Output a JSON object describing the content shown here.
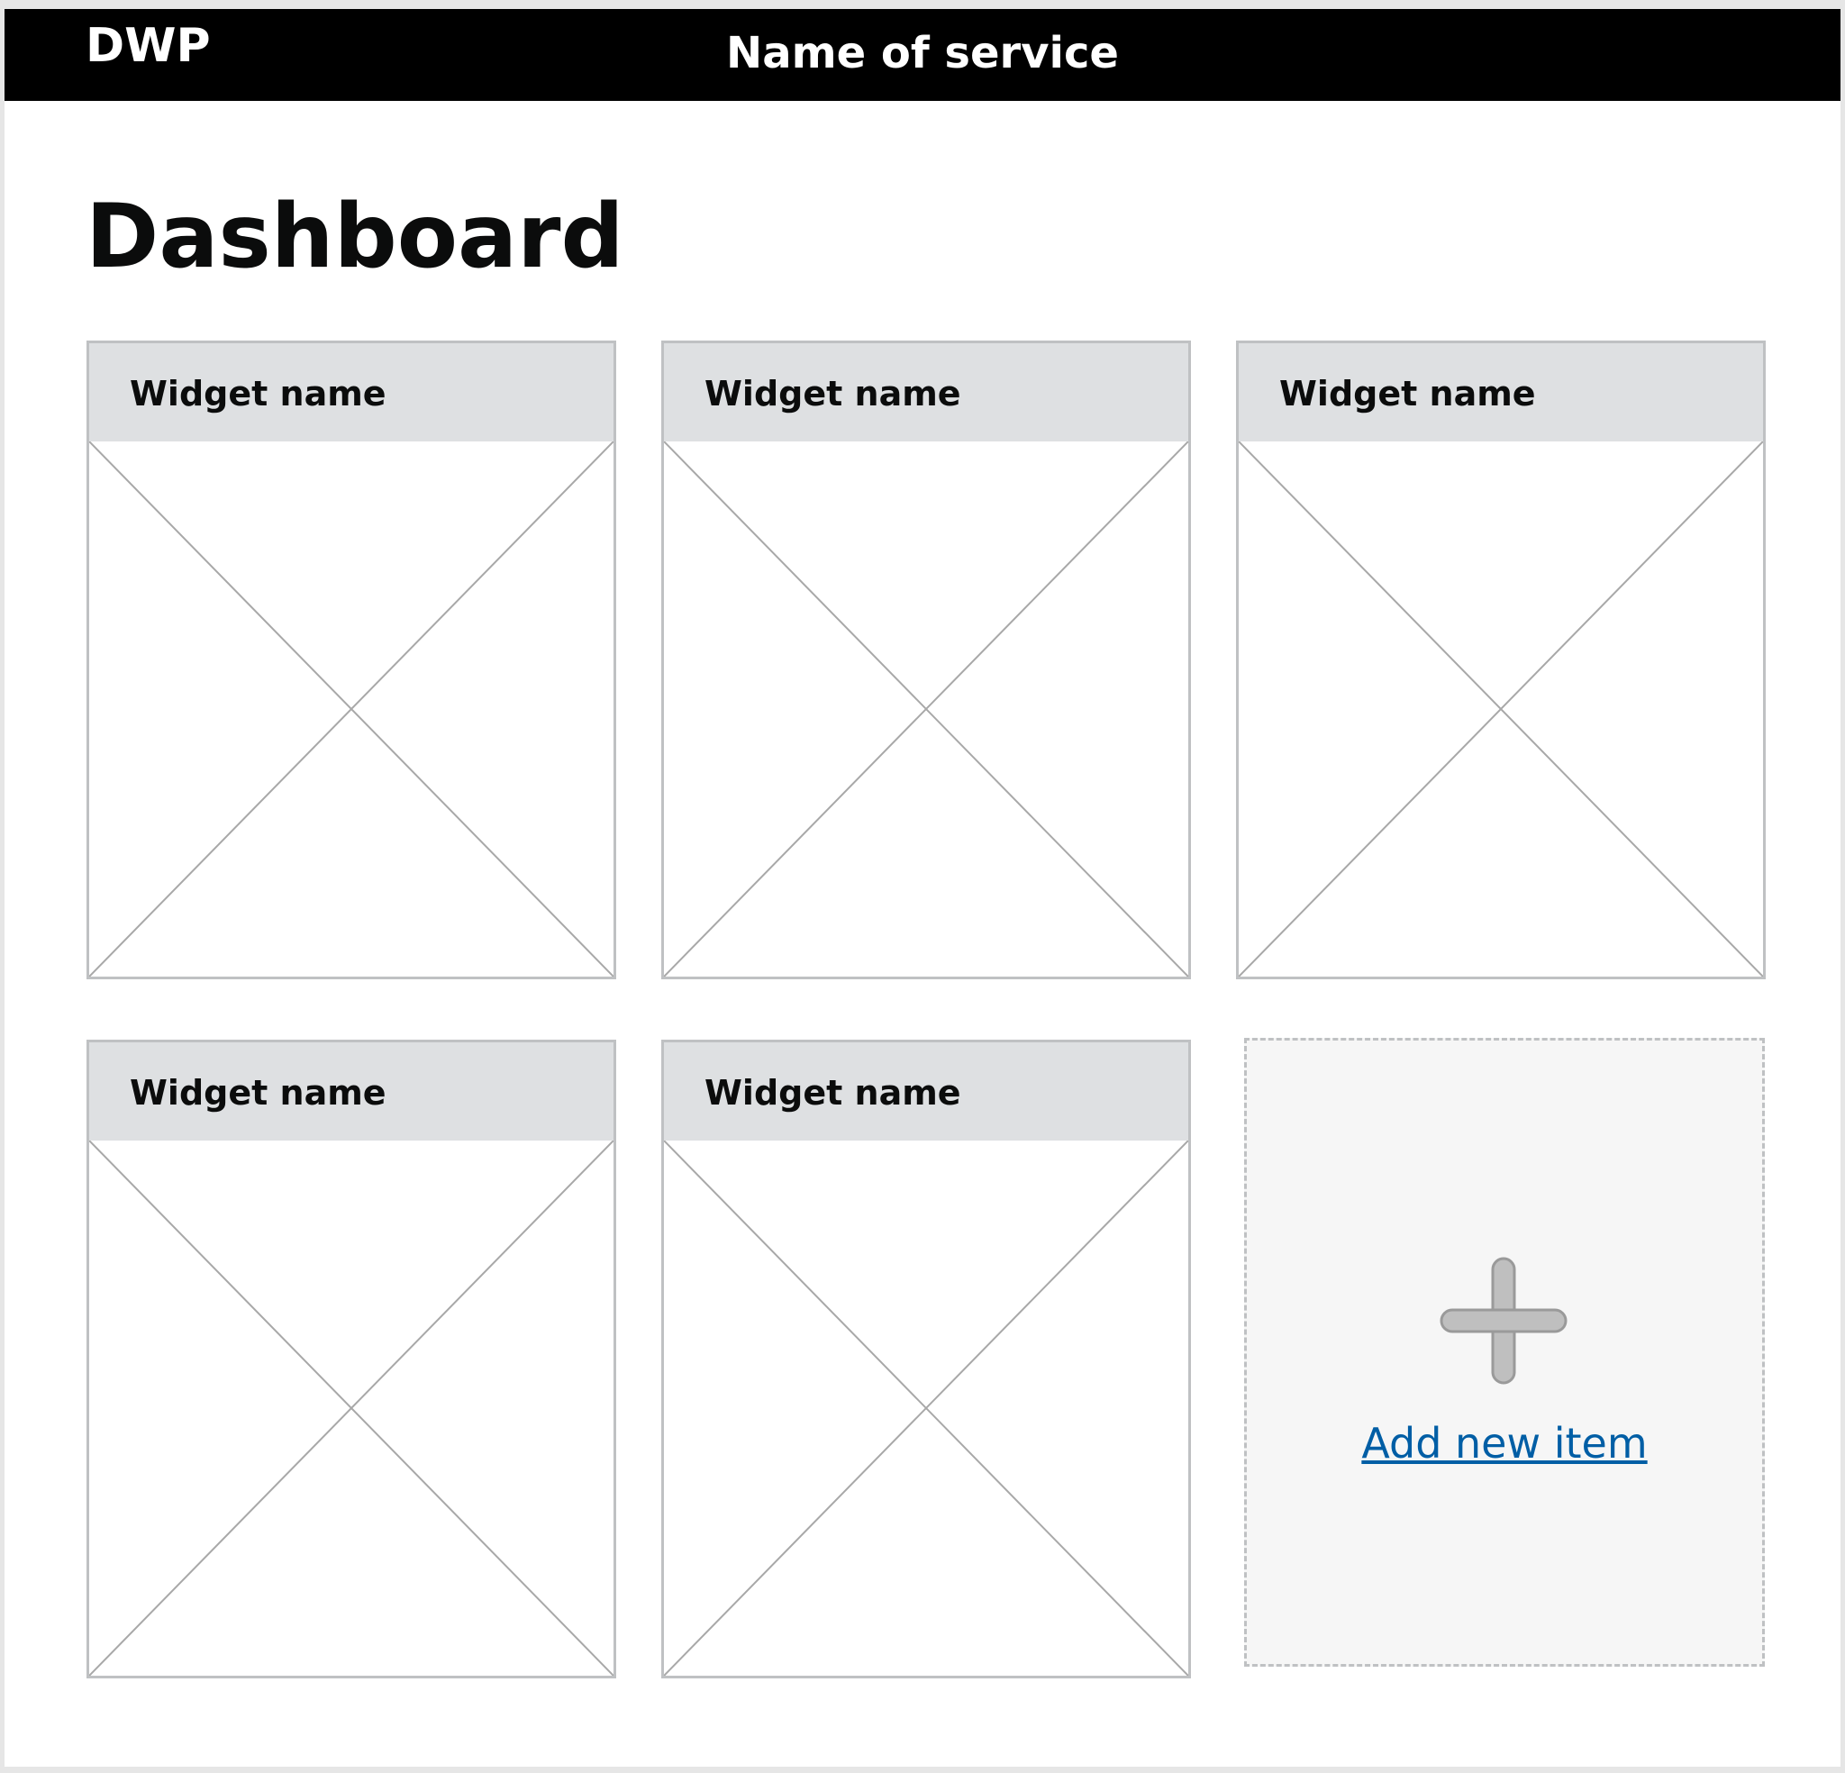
{
  "header": {
    "logo": "DWP",
    "service_name": "Name of service",
    "background": "#000000"
  },
  "page": {
    "title": "Dashboard"
  },
  "widgets": [
    {
      "title": "Widget name"
    },
    {
      "title": "Widget name"
    },
    {
      "title": "Widget name"
    },
    {
      "title": "Widget name"
    },
    {
      "title": "Widget name"
    }
  ],
  "add_item": {
    "label": "Add new item",
    "icon": "plus-icon",
    "link_color": "#005ea5"
  }
}
